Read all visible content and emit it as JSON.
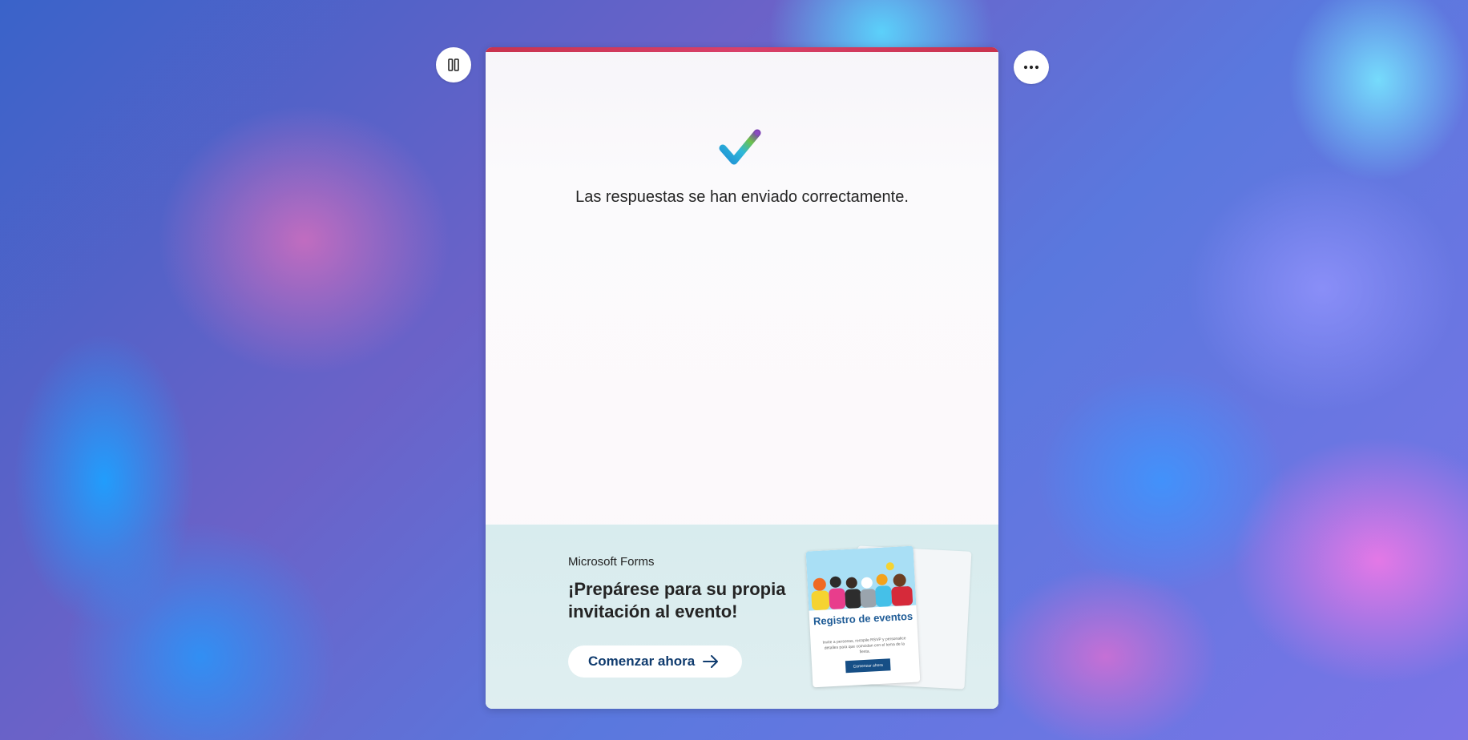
{
  "controls": {
    "pause_icon": "pause-icon",
    "more_icon": "more-icon"
  },
  "colors": {
    "accent_bar": "#c9334e",
    "cta_text": "#0f3b6e",
    "promo_bg": "#d8ecee"
  },
  "confirmation": {
    "icon": "checkmark-icon",
    "message": "Las respuestas se han enviado correctamente."
  },
  "promo": {
    "brand": "Microsoft Forms",
    "title": "¡Prepárese para su propia invitación al evento!",
    "cta_label": "Comenzar ahora",
    "cta_icon": "arrow-right-icon",
    "thumbnail": {
      "title": "Registro de eventos",
      "body": "Invite a personas, recopile RSVP y personalice detalles para que coincidan con el tema de la fiesta.",
      "button": "Comenzar ahora"
    }
  }
}
